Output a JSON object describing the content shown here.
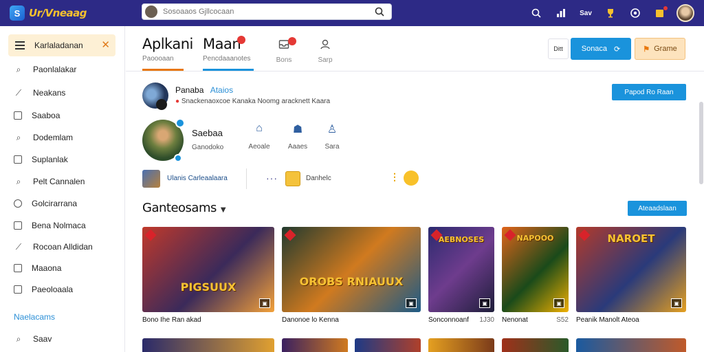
{
  "app": {
    "logo_text": "Ur/Vneaag",
    "search_placeholder": "Sosoaaos Gjllcocaan"
  },
  "topbar": {
    "icons": [
      "search-icon",
      "chart-icon",
      "mail-icon",
      "trophy-icon",
      "settings-icon",
      "notification-icon",
      "avatar"
    ],
    "mail_label": "Sav"
  },
  "sidebar": {
    "active": {
      "label": "Karlaladanan"
    },
    "items": [
      {
        "label": "Paonlalakar",
        "icon": "search-icon"
      },
      {
        "label": "Neakans",
        "icon": "wand-icon"
      },
      {
        "label": "Saaboa",
        "icon": "square-icon"
      },
      {
        "label": "Dodemlam",
        "icon": "search-icon"
      },
      {
        "label": "Suplanlak",
        "icon": "square-icon"
      },
      {
        "label": "Pelt Cannalen",
        "icon": "pin-icon"
      },
      {
        "label": "Golcirarrana",
        "icon": "circle-icon"
      },
      {
        "label": "Bena Nolmaca",
        "icon": "square-icon"
      },
      {
        "label": "Rocoan Alldidan",
        "icon": "wand-icon"
      },
      {
        "label": "Maaona",
        "icon": "square-icon"
      },
      {
        "label": "Paeoloaala",
        "icon": "square-icon"
      }
    ],
    "section_label": "Naelacams",
    "bottom_item": {
      "label": "Saav",
      "icon": "search-icon"
    }
  },
  "tabs": {
    "primary": {
      "title": "Aplkani",
      "sub": "Paoooaan"
    },
    "secondary": {
      "title": "Maan",
      "sub": "Pencdaaanotes",
      "badge": ""
    },
    "icon_tabs": [
      {
        "label": "Bons",
        "icon": "inbox-icon",
        "badge": ""
      },
      {
        "label": "Sarp",
        "icon": "person-icon"
      }
    ],
    "buttons": {
      "ghost": "Ditt",
      "primary": "Sonaca",
      "secondary": "Grame"
    }
  },
  "profile": {
    "name": "Panaba",
    "tag": "Ataios",
    "desc": "Snackenaoxcoe Kanaka Noomg aracknett Kaara",
    "report_button": "Papod Ro Raan"
  },
  "stats": [
    {
      "label": "Ganodoko",
      "big": "Saebaa"
    },
    {
      "label": "Aeoale",
      "icon": "shield-icon"
    },
    {
      "label": "Aaaes",
      "icon": "bot-icon"
    },
    {
      "label": "Sara",
      "icon": "flask-icon"
    }
  ],
  "chips": {
    "first": "Ulanis Carleaalaara",
    "second": "Danhelc"
  },
  "section": {
    "title": "Ganteosams",
    "button": "Ateaadslaan"
  },
  "cards": [
    {
      "title": "PIGSUUX",
      "cap": "Bono Ihe Ran akad",
      "val": "",
      "sub": "",
      "colors": [
        "#c0392b",
        "#3b2a5a",
        "#f3a13a"
      ]
    },
    {
      "title": "OROBS RNIAUUX",
      "cap": "Danonoe lo Kenna",
      "val": "",
      "sub": "",
      "colors": [
        "#213a2f",
        "#d07a1f",
        "#1d5a86"
      ]
    },
    {
      "title": "AEBNOSES",
      "cap": "Sonconnoanf",
      "val": "1J30",
      "sub": "",
      "colors": [
        "#2b2a6f",
        "#6e3c8d",
        "#1e1e3a"
      ]
    },
    {
      "title": "NAPOOO",
      "cap": "Nenonat",
      "val": "S52",
      "sub": "",
      "colors": [
        "#e0641a",
        "#1a4a1a",
        "#f0b000"
      ]
    },
    {
      "title": "NAROET",
      "cap": "Peanik Manolt Ateoa",
      "val": "",
      "sub": "",
      "colors": [
        "#b33a2a",
        "#2a3a7a",
        "#e5a020"
      ]
    }
  ],
  "colors": {
    "topbar": "#2d2a86",
    "accent": "#1a93dc",
    "active_bg": "#fdf0d5",
    "primary_underline": "#e8770d",
    "secondary_underline": "#1a93dc"
  }
}
